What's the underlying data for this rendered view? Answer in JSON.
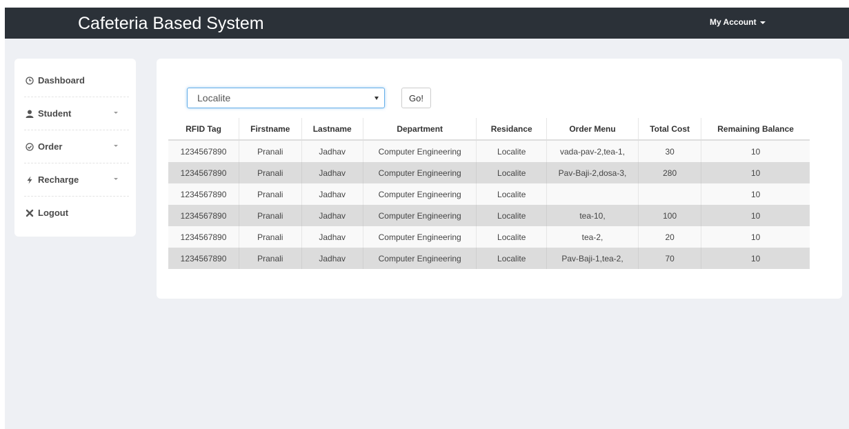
{
  "header": {
    "title": "Cafeteria Based System",
    "account_label": "My Account"
  },
  "sidebar": {
    "items": [
      {
        "label": "Dashboard",
        "icon": "clock-icon",
        "has_chevron": false
      },
      {
        "label": "Student",
        "icon": "user-icon",
        "has_chevron": true
      },
      {
        "label": "Order",
        "icon": "check-circle-icon",
        "has_chevron": true
      },
      {
        "label": "Recharge",
        "icon": "bolt-icon",
        "has_chevron": true
      },
      {
        "label": "Logout",
        "icon": "close-icon",
        "has_chevron": false
      }
    ]
  },
  "filter": {
    "selected": "Localite",
    "go_label": "Go!"
  },
  "table": {
    "columns": [
      "RFID Tag",
      "Firstname",
      "Lastname",
      "Department",
      "Residance",
      "Order Menu",
      "Total Cost",
      "Remaining Balance"
    ],
    "rows": [
      [
        "1234567890",
        "Pranali",
        "Jadhav",
        "Computer Engineering",
        "Localite",
        "vada-pav-2,tea-1,",
        "30",
        "10"
      ],
      [
        "1234567890",
        "Pranali",
        "Jadhav",
        "Computer Engineering",
        "Localite",
        "Pav-Baji-2,dosa-3,",
        "280",
        "10"
      ],
      [
        "1234567890",
        "Pranali",
        "Jadhav",
        "Computer Engineering",
        "Localite",
        "",
        "",
        "10"
      ],
      [
        "1234567890",
        "Pranali",
        "Jadhav",
        "Computer Engineering",
        "Localite",
        "tea-10,",
        "100",
        "10"
      ],
      [
        "1234567890",
        "Pranali",
        "Jadhav",
        "Computer Engineering",
        "Localite",
        "tea-2,",
        "20",
        "10"
      ],
      [
        "1234567890",
        "Pranali",
        "Jadhav",
        "Computer Engineering",
        "Localite",
        "Pav-Baji-1,tea-2,",
        "70",
        "10"
      ]
    ]
  },
  "colors": {
    "navbar": "#2b3138",
    "page_bg": "#eef0f4",
    "row_alt": "#dcdcdc",
    "focus": "#66afe9"
  }
}
